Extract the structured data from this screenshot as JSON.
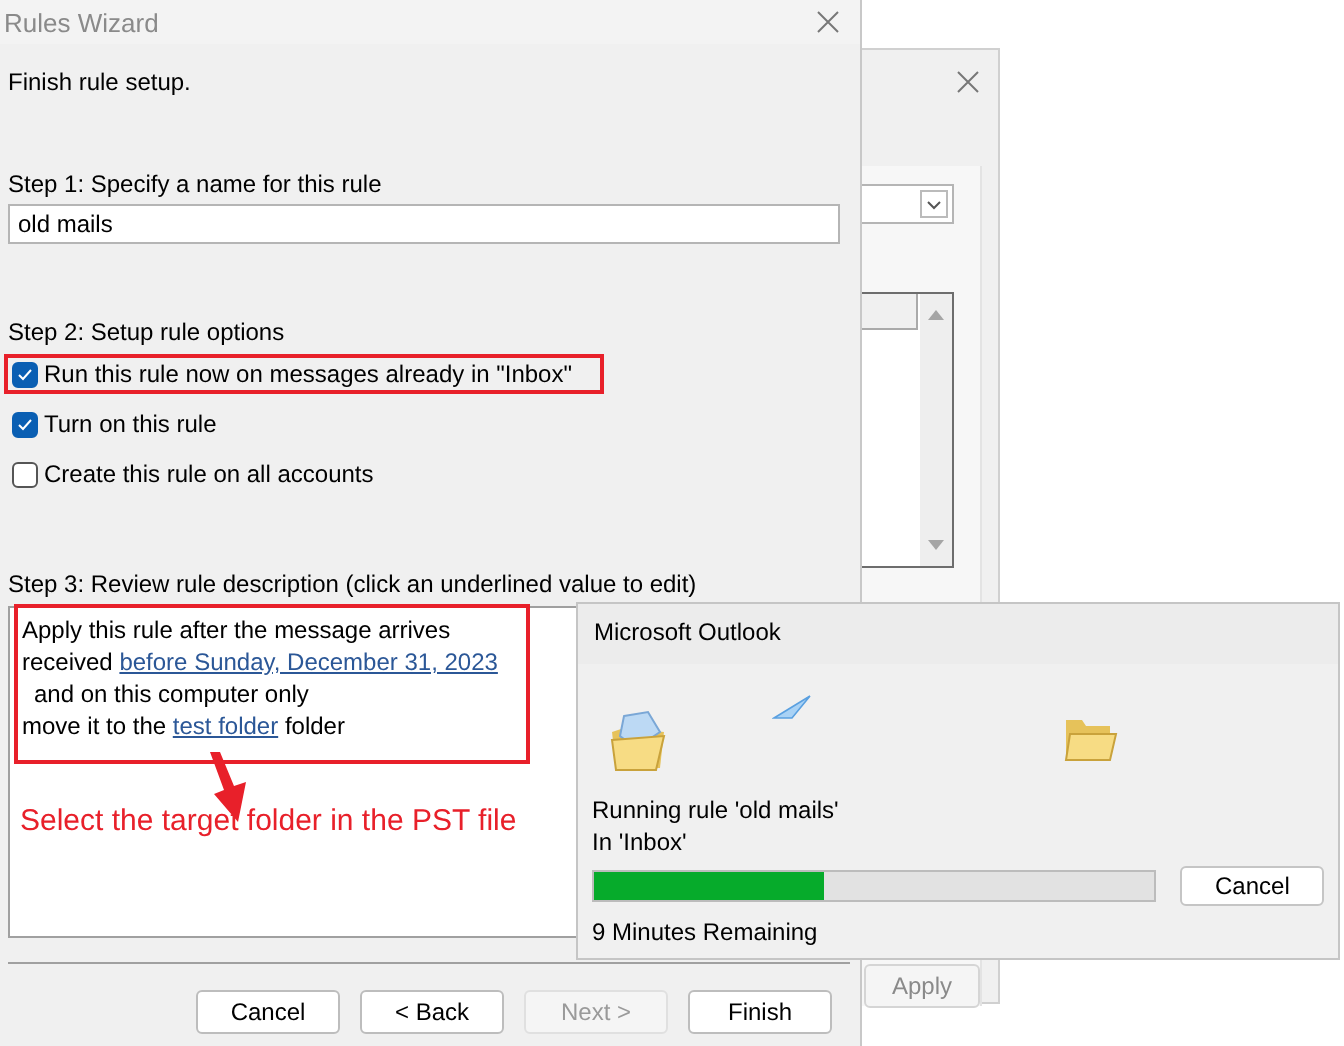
{
  "rules_wizard": {
    "title": "Rules Wizard",
    "heading": "Finish rule setup.",
    "step1_label": "Step 1: Specify a name for this rule",
    "rule_name": "old mails",
    "step2_label": "Step 2: Setup rule options",
    "options": [
      {
        "label": "Run this rule now on messages already in \"Inbox\"",
        "checked": true,
        "highlighted": true
      },
      {
        "label": "Turn on this rule",
        "checked": true,
        "highlighted": false
      },
      {
        "label": "Create this rule on all accounts",
        "checked": false,
        "highlighted": false
      }
    ],
    "step3_label": "Step 3: Review rule description (click an underlined value to edit)",
    "description": [
      {
        "indented": false,
        "parts": [
          {
            "text": "Apply this rule after the message arrives",
            "link": false
          }
        ]
      },
      {
        "indented": false,
        "parts": [
          {
            "text": "received",
            "link": false
          },
          {
            "text": "before Sunday, December 31, 2023",
            "link": true
          }
        ]
      },
      {
        "indented": true,
        "parts": [
          {
            "text": "and on this computer only",
            "link": false
          }
        ]
      },
      {
        "indented": false,
        "parts": [
          {
            "text": "move it to the",
            "link": false
          },
          {
            "text": "test folder",
            "link": true
          },
          {
            "text": "folder",
            "link": false
          }
        ]
      }
    ],
    "buttons": [
      {
        "label": "Cancel",
        "disabled": false
      },
      {
        "label": "< Back",
        "disabled": false
      },
      {
        "label": "Next >",
        "disabled": true
      },
      {
        "label": "Finish",
        "disabled": false
      }
    ]
  },
  "background_window": {
    "button": "Apply"
  },
  "progress_dialog": {
    "title": "Microsoft Outlook",
    "status": "Running rule 'old mails'",
    "folder": "In 'Inbox'",
    "level": 0.41,
    "remaining": "9 Minutes Remaining",
    "button": "Cancel"
  },
  "annotation": {
    "text": "Select the target folder in the PST file"
  }
}
